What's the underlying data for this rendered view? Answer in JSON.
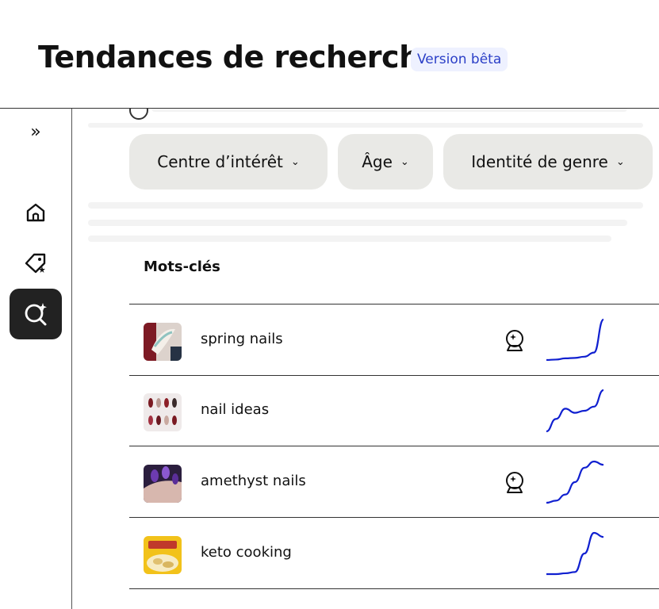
{
  "header": {
    "title": "Tendances de recherche",
    "badge": "Version bêta"
  },
  "sidebar": {
    "items": [
      {
        "name": "expand",
        "icon": "chevron-double-right-icon",
        "glyph": "»"
      },
      {
        "name": "home",
        "icon": "home-icon"
      },
      {
        "name": "tag",
        "icon": "tag-star-icon"
      },
      {
        "name": "trends",
        "icon": "search-sparkle-icon",
        "active": true
      }
    ]
  },
  "filters": [
    {
      "label": "Centre d’intérêt"
    },
    {
      "label": "Âge"
    },
    {
      "label": "Identité de genre"
    }
  ],
  "table": {
    "header": "Mots-clés",
    "rows": [
      {
        "keyword": "spring nails",
        "badge": "crystal-ball-icon",
        "trend": [
          0.02,
          0.03,
          0.06,
          0.07,
          0.1,
          0.2,
          1.0
        ]
      },
      {
        "keyword": "nail ideas",
        "badge": null,
        "trend": [
          0.0,
          0.3,
          0.55,
          0.45,
          0.5,
          0.6,
          1.0
        ]
      },
      {
        "keyword": "amethyst nails",
        "badge": "crystal-ball-icon",
        "trend": [
          0.0,
          0.05,
          0.2,
          0.5,
          0.85,
          1.0,
          0.92
        ]
      },
      {
        "keyword": "keto cooking",
        "badge": null,
        "trend": [
          0.0,
          0.0,
          0.02,
          0.05,
          0.5,
          1.0,
          0.9
        ]
      }
    ]
  },
  "colors": {
    "trend_line": "#1020d0",
    "active_nav_bg": "#222222",
    "filter_bg": "#e9e9e6",
    "badge_text": "#2b3fc7"
  }
}
